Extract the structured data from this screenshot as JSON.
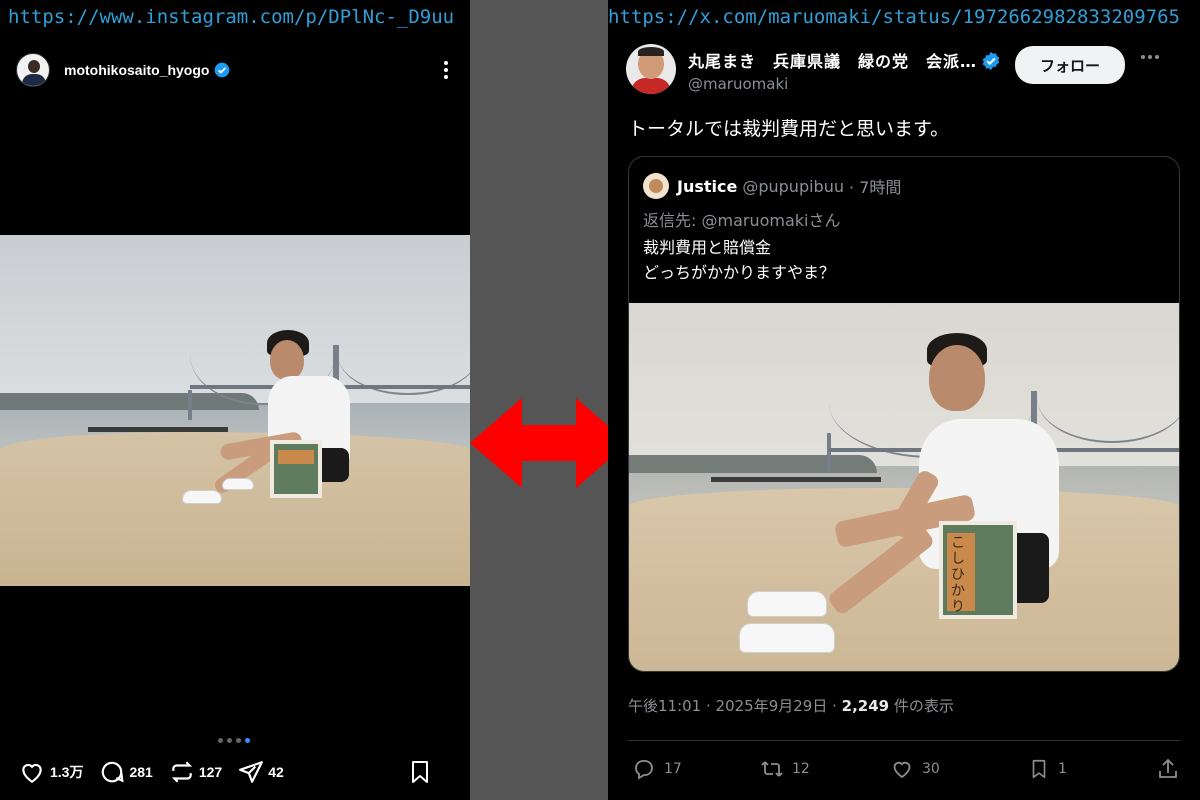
{
  "left": {
    "url": "https://www.instagram.com/p/DPlNc-_D9uu",
    "username": "motohikosaito_hyogo",
    "stats": {
      "likes": "1.3万",
      "comments": "281",
      "reposts": "127",
      "shares": "42"
    },
    "carousel": {
      "count": 4,
      "active": 3
    }
  },
  "right": {
    "url": "https://x.com/maruomaki/status/1972662982833209765",
    "display_name": "丸尾まき　兵庫県議　緑の党　会派…",
    "handle": "@maruomaki",
    "follow_label": "フォロー",
    "tweet_text": "トータルでは裁判費用だと思います。",
    "quote": {
      "name": "Justice",
      "handle": "@pupupibuu",
      "time": "· 7時間",
      "reply_to": "返信先: @maruomakiさん",
      "line1": "裁判費用と賠償金",
      "line2": "どっちがかかりますやま？"
    },
    "timestamp": "午後11:01 · 2025年9月29日 · ",
    "views_count": "2,249",
    "views_label": " 件の表示",
    "stats": {
      "replies": "17",
      "retweets": "12",
      "likes": "30",
      "bookmarks": "1"
    }
  },
  "bag_text": "こしひかり",
  "colors": {
    "link": "#2f9fd9",
    "arrow": "#ff0000",
    "divider": "#555555",
    "verified": "#1d9bf0"
  }
}
